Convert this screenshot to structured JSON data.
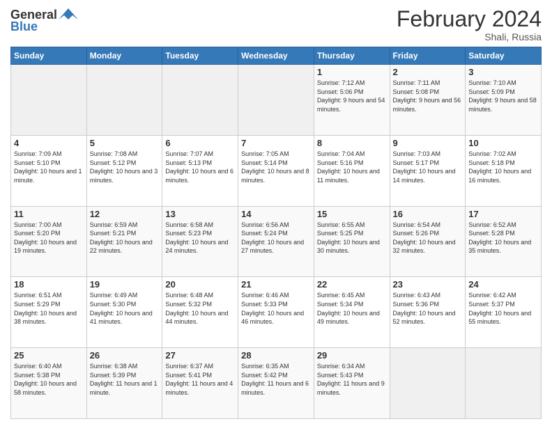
{
  "header": {
    "logo_general": "General",
    "logo_blue": "Blue",
    "month": "February 2024",
    "location": "Shali, Russia"
  },
  "weekdays": [
    "Sunday",
    "Monday",
    "Tuesday",
    "Wednesday",
    "Thursday",
    "Friday",
    "Saturday"
  ],
  "weeks": [
    [
      {
        "day": "",
        "info": ""
      },
      {
        "day": "",
        "info": ""
      },
      {
        "day": "",
        "info": ""
      },
      {
        "day": "",
        "info": ""
      },
      {
        "day": "1",
        "info": "Sunrise: 7:12 AM\nSunset: 5:06 PM\nDaylight: 9 hours\nand 54 minutes."
      },
      {
        "day": "2",
        "info": "Sunrise: 7:11 AM\nSunset: 5:08 PM\nDaylight: 9 hours\nand 56 minutes."
      },
      {
        "day": "3",
        "info": "Sunrise: 7:10 AM\nSunset: 5:09 PM\nDaylight: 9 hours\nand 58 minutes."
      }
    ],
    [
      {
        "day": "4",
        "info": "Sunrise: 7:09 AM\nSunset: 5:10 PM\nDaylight: 10 hours\nand 1 minute."
      },
      {
        "day": "5",
        "info": "Sunrise: 7:08 AM\nSunset: 5:12 PM\nDaylight: 10 hours\nand 3 minutes."
      },
      {
        "day": "6",
        "info": "Sunrise: 7:07 AM\nSunset: 5:13 PM\nDaylight: 10 hours\nand 6 minutes."
      },
      {
        "day": "7",
        "info": "Sunrise: 7:05 AM\nSunset: 5:14 PM\nDaylight: 10 hours\nand 8 minutes."
      },
      {
        "day": "8",
        "info": "Sunrise: 7:04 AM\nSunset: 5:16 PM\nDaylight: 10 hours\nand 11 minutes."
      },
      {
        "day": "9",
        "info": "Sunrise: 7:03 AM\nSunset: 5:17 PM\nDaylight: 10 hours\nand 14 minutes."
      },
      {
        "day": "10",
        "info": "Sunrise: 7:02 AM\nSunset: 5:18 PM\nDaylight: 10 hours\nand 16 minutes."
      }
    ],
    [
      {
        "day": "11",
        "info": "Sunrise: 7:00 AM\nSunset: 5:20 PM\nDaylight: 10 hours\nand 19 minutes."
      },
      {
        "day": "12",
        "info": "Sunrise: 6:59 AM\nSunset: 5:21 PM\nDaylight: 10 hours\nand 22 minutes."
      },
      {
        "day": "13",
        "info": "Sunrise: 6:58 AM\nSunset: 5:23 PM\nDaylight: 10 hours\nand 24 minutes."
      },
      {
        "day": "14",
        "info": "Sunrise: 6:56 AM\nSunset: 5:24 PM\nDaylight: 10 hours\nand 27 minutes."
      },
      {
        "day": "15",
        "info": "Sunrise: 6:55 AM\nSunset: 5:25 PM\nDaylight: 10 hours\nand 30 minutes."
      },
      {
        "day": "16",
        "info": "Sunrise: 6:54 AM\nSunset: 5:26 PM\nDaylight: 10 hours\nand 32 minutes."
      },
      {
        "day": "17",
        "info": "Sunrise: 6:52 AM\nSunset: 5:28 PM\nDaylight: 10 hours\nand 35 minutes."
      }
    ],
    [
      {
        "day": "18",
        "info": "Sunrise: 6:51 AM\nSunset: 5:29 PM\nDaylight: 10 hours\nand 38 minutes."
      },
      {
        "day": "19",
        "info": "Sunrise: 6:49 AM\nSunset: 5:30 PM\nDaylight: 10 hours\nand 41 minutes."
      },
      {
        "day": "20",
        "info": "Sunrise: 6:48 AM\nSunset: 5:32 PM\nDaylight: 10 hours\nand 44 minutes."
      },
      {
        "day": "21",
        "info": "Sunrise: 6:46 AM\nSunset: 5:33 PM\nDaylight: 10 hours\nand 46 minutes."
      },
      {
        "day": "22",
        "info": "Sunrise: 6:45 AM\nSunset: 5:34 PM\nDaylight: 10 hours\nand 49 minutes."
      },
      {
        "day": "23",
        "info": "Sunrise: 6:43 AM\nSunset: 5:36 PM\nDaylight: 10 hours\nand 52 minutes."
      },
      {
        "day": "24",
        "info": "Sunrise: 6:42 AM\nSunset: 5:37 PM\nDaylight: 10 hours\nand 55 minutes."
      }
    ],
    [
      {
        "day": "25",
        "info": "Sunrise: 6:40 AM\nSunset: 5:38 PM\nDaylight: 10 hours\nand 58 minutes."
      },
      {
        "day": "26",
        "info": "Sunrise: 6:38 AM\nSunset: 5:39 PM\nDaylight: 11 hours\nand 1 minute."
      },
      {
        "day": "27",
        "info": "Sunrise: 6:37 AM\nSunset: 5:41 PM\nDaylight: 11 hours\nand 4 minutes."
      },
      {
        "day": "28",
        "info": "Sunrise: 6:35 AM\nSunset: 5:42 PM\nDaylight: 11 hours\nand 6 minutes."
      },
      {
        "day": "29",
        "info": "Sunrise: 6:34 AM\nSunset: 5:43 PM\nDaylight: 11 hours\nand 9 minutes."
      },
      {
        "day": "",
        "info": ""
      },
      {
        "day": "",
        "info": ""
      }
    ]
  ]
}
